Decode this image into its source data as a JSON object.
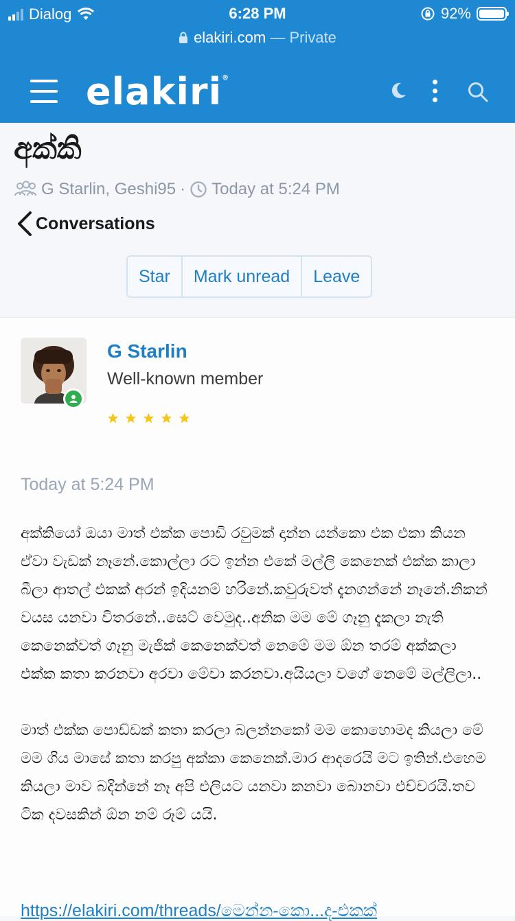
{
  "status_bar": {
    "carrier": "Dialog",
    "time": "6:28 PM",
    "battery_percent": "92%"
  },
  "url_bar": {
    "domain": "elakiri.com",
    "mode": "— Private"
  },
  "header": {
    "logo_text": "elakiri",
    "icons": [
      "menu-icon",
      "moon-icon",
      "more-vertical-icon",
      "search-icon"
    ]
  },
  "conversation": {
    "title": "අක්කි",
    "participants": "G Starlin, Geshi95",
    "separator": "·",
    "time": "Today at 5:24 PM",
    "back_label": "Conversations",
    "actions": [
      "Star",
      "Mark unread",
      "Leave"
    ]
  },
  "message": {
    "author": "G Starlin",
    "user_title": "Well-known member",
    "rating_stars": 5,
    "timestamp": "Today at 5:24 PM",
    "paragraphs": [
      "අක්කියෝ ඔයා මාත් එක්ක පොඩි රවුමක් දාන්න යන්කො එක එකා කියන ඒවා වැඩක් නෑනේ.කොල්ලා රට ඉන්න එකේ මල්ලි කෙනෙක් එක්ක කාලා බීලා ආතල් එකක් අරන් ඉදියනම් හරිනේ.කවුරුවත් දැනගන්නේ නෑනේ.නිකන් වයස යනවා විතරනේ..සෙට් වෙමුද..අනික මම මේ ගෑනු දැකලා නැති කෙනෙක්වත් ගෑනු මැජික් කෙනෙක්වත් නෙමේ මම ඕන තරම් අක්කලා එක්ක කතා කරනවා අරවා මේවා කරනවා.අයියලා වගේ නෙමේ මල්ලිලා..",
      "මාත් එක්ක පොඩ්ඩක් කතා කරලා බලන්නකෝ මම කොහොමද කියලා මේ මම ගිය මාසේ කතා කරපු අක්කා කෙනෙක්.මාර ආදරෙයි මට ඉතින්.එහෙම කියලා මාව බදින්නේ නෑ අපි එලියට යනවා කනවා බොනවා එච්චරයි.තව ටික දවසකින් ඕන නම් රූම් යයි."
    ],
    "link_text": "https://elakiri.com/threads/මෙන්න-කො...ද-එකක්"
  },
  "colors": {
    "brand_blue": "#1f88d3",
    "link_blue": "#1f7fc5",
    "online_green": "#2fae4f",
    "star_yellow": "#f5c518"
  }
}
